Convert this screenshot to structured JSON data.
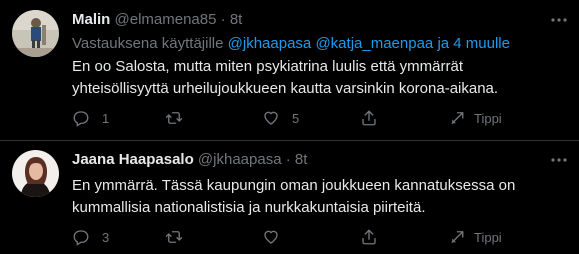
{
  "tweets": [
    {
      "name": "Malin",
      "handle": "@elmamena85",
      "separator": "·",
      "time": "8t",
      "reply_prefix": "Vastauksena käyttäjille",
      "mention_1": "@jkhaapasa",
      "mention_2": "@katja_maenpaa",
      "and_more": "ja 4 muulle",
      "text": "En oo Salosta, mutta miten psykiatrina luulis että ymmärrät yhteisöllisyyttä urheilujoukkueen kautta varsinkin korona-aikana.",
      "reply_count": "1",
      "retweet_count": "",
      "like_count": "5",
      "tip_label": "Tippi"
    },
    {
      "name": "Jaana Haapasalo",
      "handle": "@jkhaapasa",
      "separator": "·",
      "time": "8t",
      "text": "En ymmärrä. Tässä kaupungin oman joukkueen kannatuksessa on kummallisia nationalistisia ja nurkkakuntaisia piirteitä.",
      "reply_count": "3",
      "retweet_count": "",
      "like_count": "",
      "tip_label": "Tippi"
    }
  ],
  "icons": {
    "reply": "reply-icon",
    "retweet": "retweet-icon",
    "like": "heart-icon",
    "share": "share-icon",
    "tip": "tip-icon",
    "more": "more-icon"
  },
  "colors": {
    "background": "#000000",
    "text": "#e7e9ea",
    "muted": "#71767b",
    "link": "#1d9bf0",
    "divider": "#2f3336"
  }
}
